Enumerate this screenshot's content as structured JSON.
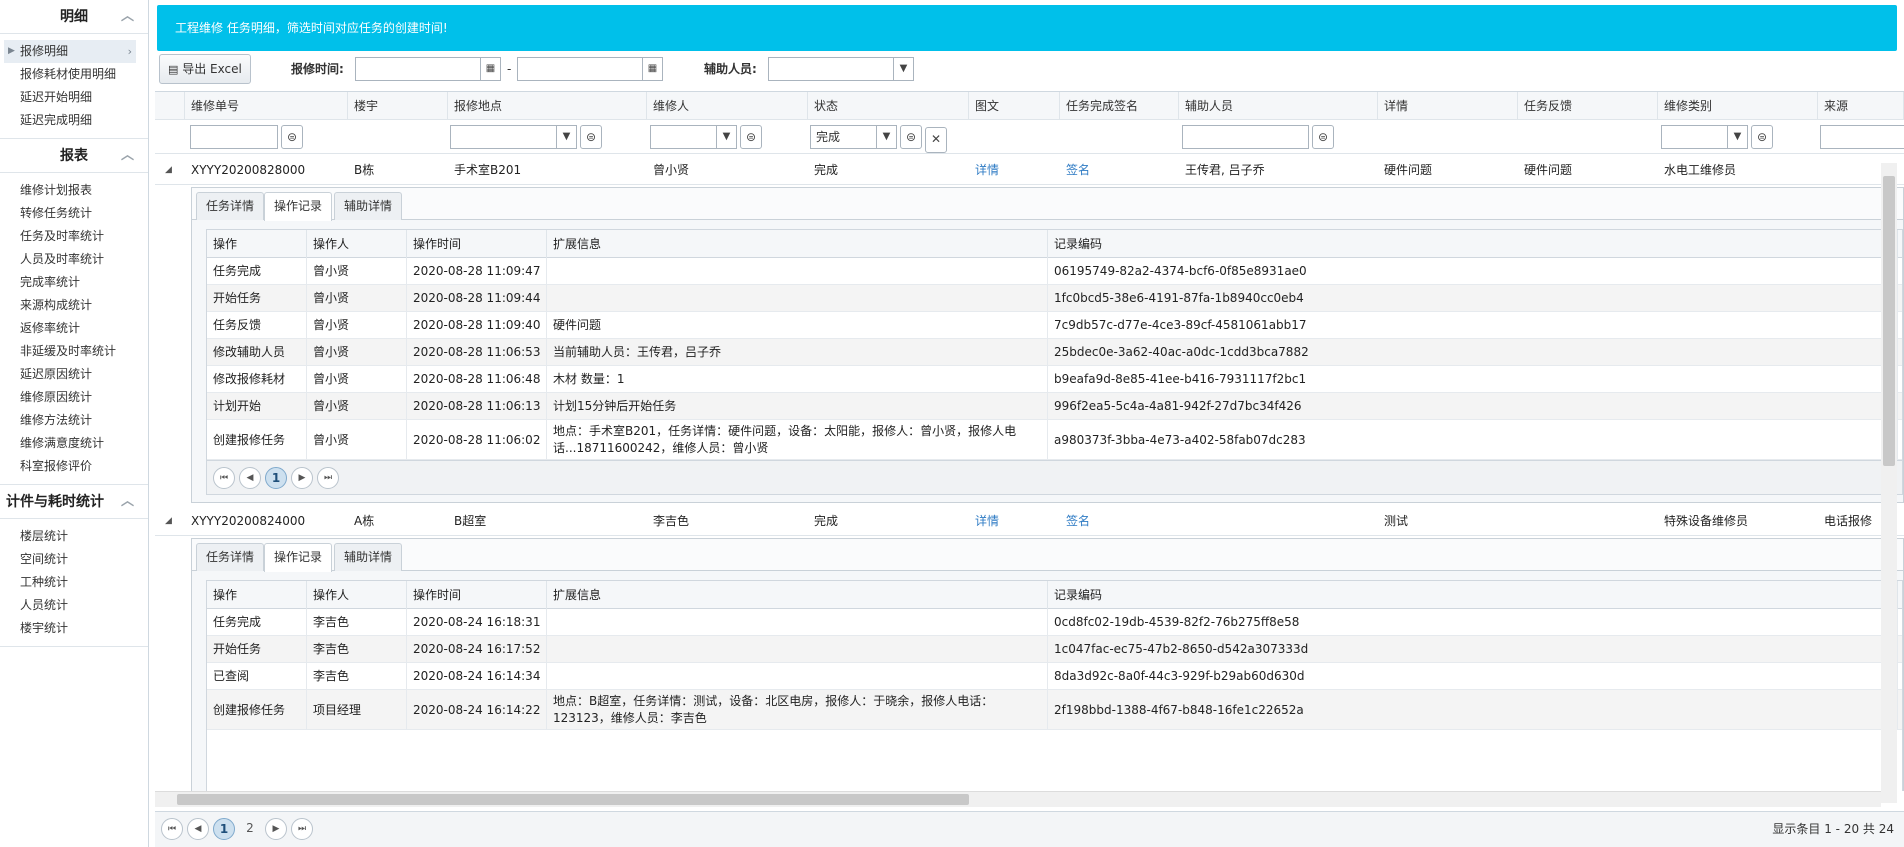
{
  "sidebar": {
    "sections": [
      {
        "title": "明细",
        "items": [
          "报修明细",
          "报修耗材使用明细",
          "延迟开始明细",
          "延迟完成明细"
        ]
      },
      {
        "title": "报表",
        "items": [
          "维修计划报表",
          "转修任务统计",
          "任务及时率统计",
          "人员及时率统计",
          "完成率统计",
          "来源构成统计",
          "返修率统计",
          "非延缓及时率统计",
          "延迟原因统计",
          "维修原因统计",
          "维修方法统计",
          "维修满意度统计",
          "科室报修评价"
        ]
      },
      {
        "title": "计件与耗时统计",
        "items": [
          "楼层统计",
          "空间统计",
          "工种统计",
          "人员统计",
          "楼宇统计"
        ]
      }
    ]
  },
  "banner": {
    "text": "工程维修 任务明细，筛选时间对应任务的创建时间!"
  },
  "toolbar": {
    "export_label": "导出 Excel",
    "time_label": "报修时间:",
    "dash": "-",
    "assist_label": "辅助人员:"
  },
  "grid": {
    "columns": [
      "维修单号",
      "楼宇",
      "报修地点",
      "维修人",
      "状态",
      "图文",
      "任务完成签名",
      "辅助人员",
      "详情",
      "任务反馈",
      "维修类别",
      "来源"
    ],
    "filter_status": "完成",
    "rows": [
      {
        "id": "XYYY20200828000",
        "building": "B栋",
        "location": "手术室B201",
        "repairer": "曾小贤",
        "status": "完成",
        "pic": "详情",
        "sign": "签名",
        "assistant": "王传君, 吕子乔",
        "detail": "硬件问题",
        "feedback": "硬件问题",
        "category": "水电工维修员",
        "source": ""
      },
      {
        "id": "XYYY20200824000",
        "building": "A栋",
        "location": "B超室",
        "repairer": "李吉色",
        "status": "完成",
        "pic": "详情",
        "sign": "签名",
        "assistant": "",
        "detail": "测试",
        "feedback": "",
        "category": "特殊设备维修员",
        "source": "电话报修"
      }
    ]
  },
  "detail_tabs": [
    "任务详情",
    "操作记录",
    "辅助详情"
  ],
  "log_columns": [
    "操作",
    "操作人",
    "操作时间",
    "扩展信息",
    "记录编码"
  ],
  "logs1": [
    [
      "任务完成",
      "曾小贤",
      "2020-08-28 11:09:47",
      "",
      "06195749-82a2-4374-bcf6-0f85e8931ae0"
    ],
    [
      "开始任务",
      "曾小贤",
      "2020-08-28 11:09:44",
      "",
      "1fc0bcd5-38e6-4191-87fa-1b8940cc0eb4"
    ],
    [
      "任务反馈",
      "曾小贤",
      "2020-08-28 11:09:40",
      "硬件问题",
      "7c9db57c-d77e-4ce3-89cf-4581061abb17"
    ],
    [
      "修改辅助人员",
      "曾小贤",
      "2020-08-28 11:06:53",
      "当前辅助人员：王传君，吕子乔",
      "25bdec0e-3a62-40ac-a0dc-1cdd3bca7882"
    ],
    [
      "修改报修耗材",
      "曾小贤",
      "2020-08-28 11:06:48",
      "木材 数量：1",
      "b9eafa9d-8e85-41ee-b416-7931117f2bc1"
    ],
    [
      "计划开始",
      "曾小贤",
      "2020-08-28 11:06:13",
      "计划15分钟后开始任务",
      "996f2ea5-5c4a-4a81-942f-27d7bc34f426"
    ],
    [
      "创建报修任务",
      "曾小贤",
      "2020-08-28 11:06:02",
      "地点：手术室B201，任务详情：硬件问题，设备：太阳能，报修人：曾小贤，报修人电话...18711600242，维修人员：曾小贤",
      "a980373f-3bba-4e73-a402-58fab07dc283"
    ]
  ],
  "logs2": [
    [
      "任务完成",
      "李吉色",
      "2020-08-24 16:18:31",
      "",
      "0cd8fc02-19db-4539-82f2-76b275ff8e58"
    ],
    [
      "开始任务",
      "李吉色",
      "2020-08-24 16:17:52",
      "",
      "1c047fac-ec75-47b2-8650-d542a307333d"
    ],
    [
      "已查阅",
      "李吉色",
      "2020-08-24 16:14:34",
      "",
      "8da3d92c-8a0f-44c3-929f-b29ab60d630d"
    ],
    [
      "创建报修任务",
      "项目经理",
      "2020-08-24 16:14:22",
      "地点：B超室，任务详情：测试，设备：北区电房，报修人：于晓余，报修人电话：123123，维修人员：李吉色",
      "2f198bbd-1388-4f67-b848-16fe1c22652a"
    ]
  ],
  "sub_pager": {
    "current": "1"
  },
  "footer": {
    "pages": [
      "1",
      "2"
    ],
    "summary": "显示条目 1 - 20 共 24"
  }
}
